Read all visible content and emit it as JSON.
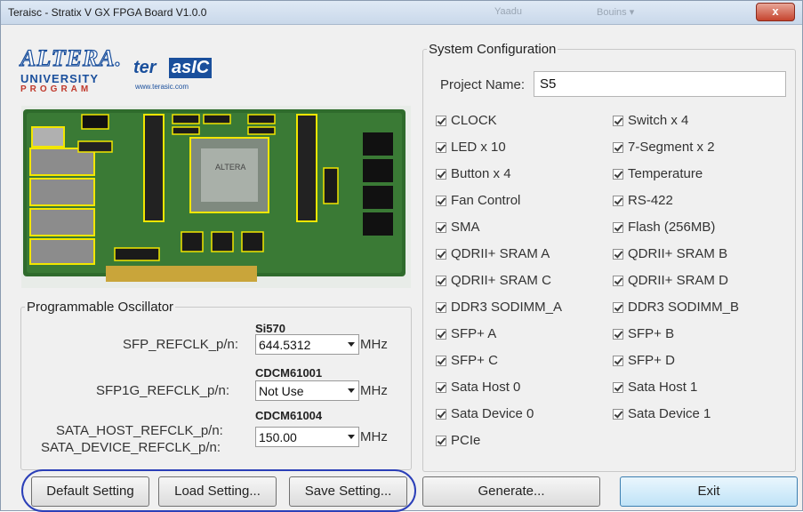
{
  "window": {
    "title": "Teraisc - Stratix V GX FPGA Board V1.0.0",
    "ghost_text_1": "Yaadu",
    "ghost_text_2": "Bouins ▾",
    "close_glyph": "x"
  },
  "logos": {
    "altera": "ALTERA.",
    "university": "UNIVERSITY",
    "program": "PROGRAM",
    "terasic_ter": "ter",
    "terasic_asic": "asIC",
    "terasic_url": "www.terasic.com"
  },
  "oscillator": {
    "legend": "Programmable Oscillator",
    "rows": [
      {
        "chip": "Si570",
        "label": "SFP_REFCLK_p/n:",
        "value": "644.5312",
        "unit": "MHz"
      },
      {
        "chip": "CDCM61001",
        "label": "SFP1G_REFCLK_p/n:",
        "value": "Not Use",
        "unit": "MHz"
      },
      {
        "chip": "CDCM61004",
        "label": "SATA_HOST_REFCLK_p/n:",
        "label2": "SATA_DEVICE_REFCLK_p/n:",
        "value": "150.00",
        "unit": "MHz"
      }
    ]
  },
  "system": {
    "legend": "System Configuration",
    "project_label": "Project Name:",
    "project_name": "S5",
    "left_items": [
      "CLOCK",
      "LED x 10",
      "Button x 4",
      "Fan Control",
      "SMA",
      "QDRII+ SRAM A",
      "QDRII+ SRAM C",
      "DDR3 SODIMM_A",
      "SFP+ A",
      "SFP+ C",
      "Sata Host 0",
      "Sata Device 0",
      "PCIe"
    ],
    "right_items": [
      "Switch x 4",
      "7-Segment x 2",
      "Temperature",
      "RS-422",
      "Flash (256MB)",
      "QDRII+ SRAM B",
      "QDRII+ SRAM D",
      "DDR3 SODIMM_B",
      "SFP+ B",
      "SFP+ D",
      "Sata Host 1",
      "Sata Device 1"
    ]
  },
  "buttons": {
    "default_setting": "Default Setting",
    "load_setting": "Load Setting...",
    "save_setting": "Save Setting...",
    "generate": "Generate...",
    "exit": "Exit"
  },
  "colors": {
    "highlight_oval": "#2b3fb8",
    "pcb_green": "#2f6b2c",
    "component_outline": "#f2e600"
  }
}
